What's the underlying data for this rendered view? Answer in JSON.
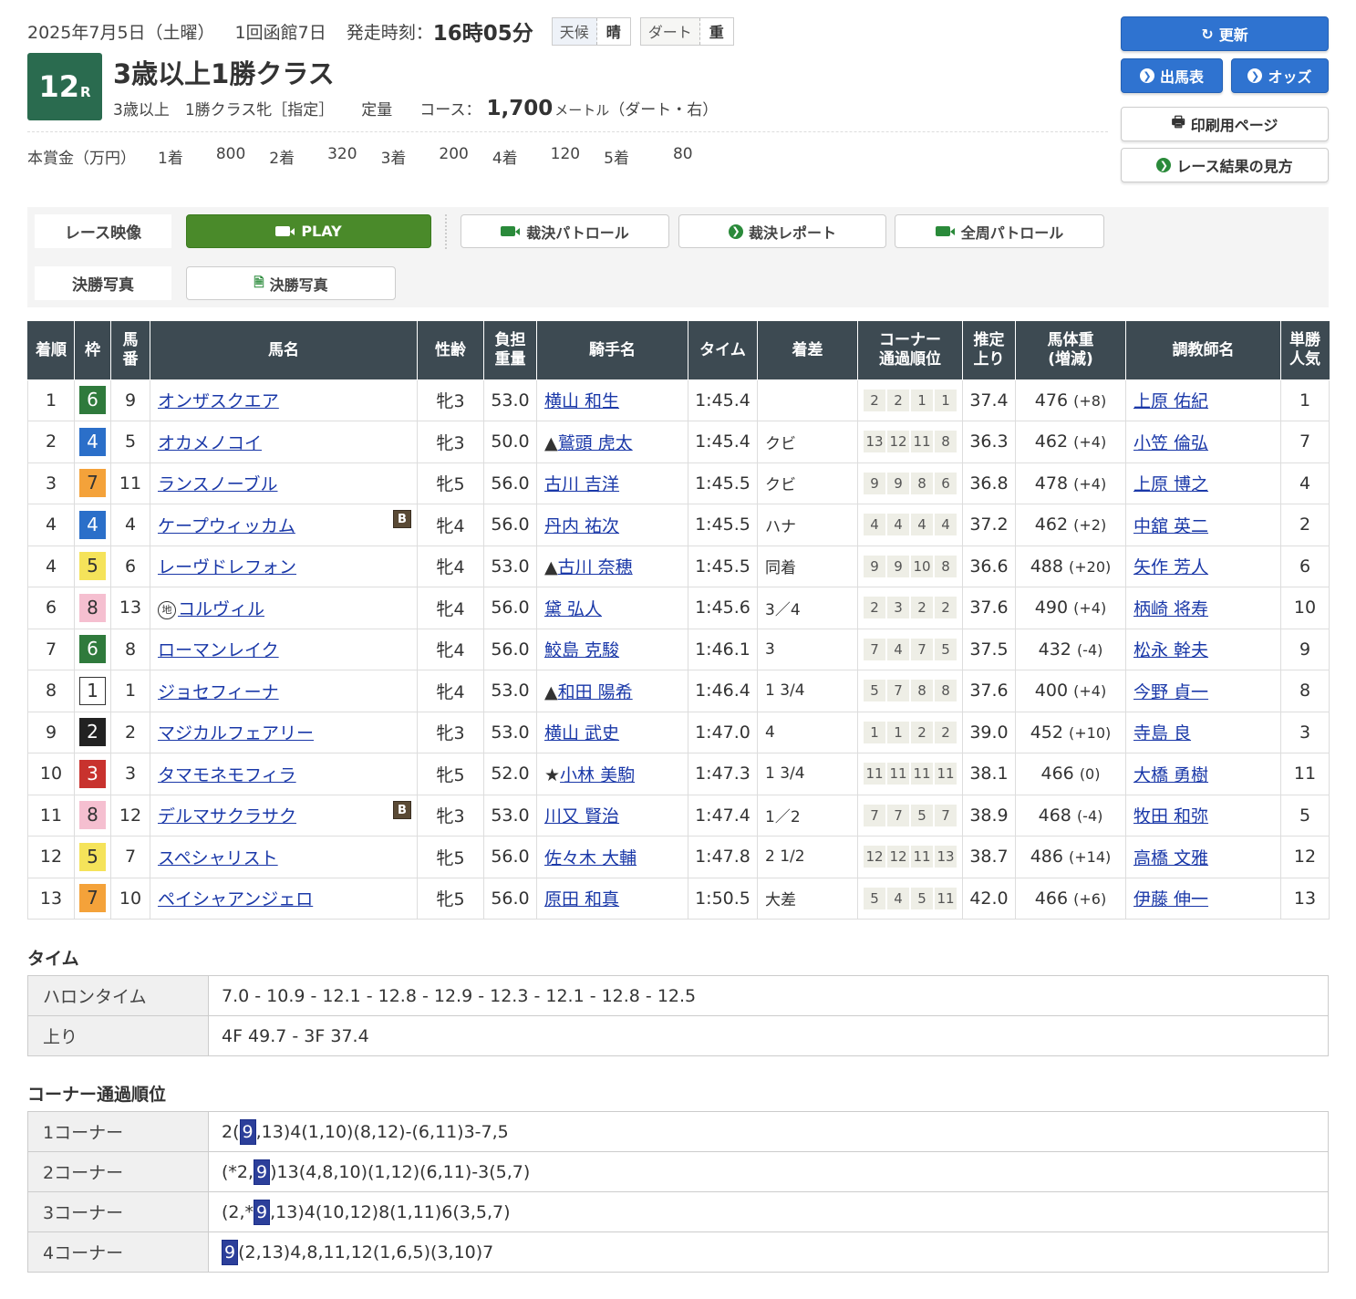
{
  "header": {
    "date": "2025年7月5日（土曜）",
    "meeting": "1回函館7日",
    "start_label": "発走時刻：",
    "start_time": "16時05分",
    "weather_label": "天候",
    "weather": "晴",
    "track_label": "ダート",
    "track_condition": "重",
    "race_no": "12",
    "race_no_suffix": "R",
    "title": "3歳以上1勝クラス",
    "class_text": "3歳以上　1勝クラス牝［指定］",
    "weight_rule": "定量",
    "course_label": "コース：",
    "distance": "1,700",
    "distance_unit": "メートル",
    "course_note": "（ダート・右）",
    "prize_label": "本賞金（万円）",
    "prizes": [
      {
        "place": "1着",
        "amount": "800"
      },
      {
        "place": "2着",
        "amount": "320"
      },
      {
        "place": "3着",
        "amount": "200"
      },
      {
        "place": "4着",
        "amount": "120"
      },
      {
        "place": "5着",
        "amount": "80"
      }
    ]
  },
  "buttons": {
    "update": "更新",
    "entries": "出馬表",
    "odds": "オッズ",
    "print": "印刷用ページ",
    "guide": "レース結果の見方"
  },
  "media": {
    "video_label": "レース映像",
    "play": "PLAY",
    "patrol": "裁決パトロール",
    "report": "裁決レポート",
    "full_patrol": "全周パトロール",
    "photo_label": "決勝写真",
    "photo_button": "決勝写真"
  },
  "table": {
    "headers": {
      "rank": "着順",
      "waku": "枠",
      "num": "馬番",
      "horse": "馬名",
      "sexage": "性齢",
      "weight": "負担重量",
      "jockey": "騎手名",
      "time": "タイム",
      "margin": "着差",
      "corner": "コーナー通過順位",
      "last3f": "推定上り",
      "bodyweight": "馬体重(増減)",
      "trainer": "調教師名",
      "pop": "単勝人気"
    },
    "rows": [
      {
        "rank": "1",
        "waku": "6",
        "num": "9",
        "horse": "オンザスクエア",
        "blinker": false,
        "chihou": false,
        "sexage": "牝3",
        "weight": "53.0",
        "jmark": "",
        "jockey": "横山 和生",
        "time": "1:45.4",
        "margin": "",
        "corners": [
          "2",
          "2",
          "1",
          "1"
        ],
        "last3f": "37.4",
        "bw": "476",
        "bwd": "(+8)",
        "trainer": "上原 佑紀",
        "pop": "1"
      },
      {
        "rank": "2",
        "waku": "4",
        "num": "5",
        "horse": "オカメノコイ",
        "blinker": false,
        "chihou": false,
        "sexage": "牝3",
        "weight": "50.0",
        "jmark": "▲",
        "jockey": "鷲頭 虎太",
        "time": "1:45.4",
        "margin": "クビ",
        "corners": [
          "13",
          "12",
          "11",
          "8"
        ],
        "last3f": "36.3",
        "bw": "462",
        "bwd": "(+4)",
        "trainer": "小笠 倫弘",
        "pop": "7"
      },
      {
        "rank": "3",
        "waku": "7",
        "num": "11",
        "horse": "ランスノーブル",
        "blinker": false,
        "chihou": false,
        "sexage": "牝5",
        "weight": "56.0",
        "jmark": "",
        "jockey": "古川 吉洋",
        "time": "1:45.5",
        "margin": "クビ",
        "corners": [
          "9",
          "9",
          "8",
          "6"
        ],
        "last3f": "36.8",
        "bw": "478",
        "bwd": "(+4)",
        "trainer": "上原 博之",
        "pop": "4"
      },
      {
        "rank": "4",
        "waku": "4",
        "num": "4",
        "horse": "ケープウィッカム",
        "blinker": true,
        "chihou": false,
        "sexage": "牝4",
        "weight": "56.0",
        "jmark": "",
        "jockey": "丹内 祐次",
        "time": "1:45.5",
        "margin": "ハナ",
        "corners": [
          "4",
          "4",
          "4",
          "4"
        ],
        "last3f": "37.2",
        "bw": "462",
        "bwd": "(+2)",
        "trainer": "中舘 英二",
        "pop": "2"
      },
      {
        "rank": "4",
        "waku": "5",
        "num": "6",
        "horse": "レーヴドレフォン",
        "blinker": false,
        "chihou": false,
        "sexage": "牝4",
        "weight": "53.0",
        "jmark": "▲",
        "jockey": "古川 奈穂",
        "time": "1:45.5",
        "margin": "同着",
        "corners": [
          "9",
          "9",
          "10",
          "8"
        ],
        "last3f": "36.6",
        "bw": "488",
        "bwd": "(+20)",
        "trainer": "矢作 芳人",
        "pop": "6"
      },
      {
        "rank": "6",
        "waku": "8",
        "num": "13",
        "horse": "コルヴィル",
        "blinker": false,
        "chihou": true,
        "sexage": "牝4",
        "weight": "56.0",
        "jmark": "",
        "jockey": "黛 弘人",
        "time": "1:45.6",
        "margin": "3／4",
        "corners": [
          "2",
          "3",
          "2",
          "2"
        ],
        "last3f": "37.6",
        "bw": "490",
        "bwd": "(+4)",
        "trainer": "柄崎 将寿",
        "pop": "10"
      },
      {
        "rank": "7",
        "waku": "6",
        "num": "8",
        "horse": "ローマンレイク",
        "blinker": false,
        "chihou": false,
        "sexage": "牝4",
        "weight": "56.0",
        "jmark": "",
        "jockey": "鮫島 克駿",
        "time": "1:46.1",
        "margin": "3",
        "corners": [
          "7",
          "4",
          "7",
          "5"
        ],
        "last3f": "37.5",
        "bw": "432",
        "bwd": "(-4)",
        "trainer": "松永 幹夫",
        "pop": "9"
      },
      {
        "rank": "8",
        "waku": "1",
        "num": "1",
        "horse": "ジョセフィーナ",
        "blinker": false,
        "chihou": false,
        "sexage": "牝4",
        "weight": "53.0",
        "jmark": "▲",
        "jockey": "和田 陽希",
        "time": "1:46.4",
        "margin": "1 3/4",
        "corners": [
          "5",
          "7",
          "8",
          "8"
        ],
        "last3f": "37.6",
        "bw": "400",
        "bwd": "(+4)",
        "trainer": "今野 貞一",
        "pop": "8"
      },
      {
        "rank": "9",
        "waku": "2",
        "num": "2",
        "horse": "マジカルフェアリー",
        "blinker": false,
        "chihou": false,
        "sexage": "牝3",
        "weight": "53.0",
        "jmark": "",
        "jockey": "横山 武史",
        "time": "1:47.0",
        "margin": "4",
        "corners": [
          "1",
          "1",
          "2",
          "2"
        ],
        "last3f": "39.0",
        "bw": "452",
        "bwd": "(+10)",
        "trainer": "寺島 良",
        "pop": "3"
      },
      {
        "rank": "10",
        "waku": "3",
        "num": "3",
        "horse": "タマモネモフィラ",
        "blinker": false,
        "chihou": false,
        "sexage": "牝5",
        "weight": "52.0",
        "jmark": "★",
        "jockey": "小林 美駒",
        "time": "1:47.3",
        "margin": "1 3/4",
        "corners": [
          "11",
          "11",
          "11",
          "11"
        ],
        "last3f": "38.1",
        "bw": "466",
        "bwd": "(0)",
        "trainer": "大橋 勇樹",
        "pop": "11"
      },
      {
        "rank": "11",
        "waku": "8",
        "num": "12",
        "horse": "デルマサクラサク",
        "blinker": true,
        "chihou": false,
        "sexage": "牝3",
        "weight": "53.0",
        "jmark": "",
        "jockey": "川又 賢治",
        "time": "1:47.4",
        "margin": "1／2",
        "corners": [
          "7",
          "7",
          "5",
          "7"
        ],
        "last3f": "38.9",
        "bw": "468",
        "bwd": "(-4)",
        "trainer": "牧田 和弥",
        "pop": "5"
      },
      {
        "rank": "12",
        "waku": "5",
        "num": "7",
        "horse": "スペシャリスト",
        "blinker": false,
        "chihou": false,
        "sexage": "牝5",
        "weight": "56.0",
        "jmark": "",
        "jockey": "佐々木 大輔",
        "time": "1:47.8",
        "margin": "2 1/2",
        "corners": [
          "12",
          "12",
          "11",
          "13"
        ],
        "last3f": "38.7",
        "bw": "486",
        "bwd": "(+14)",
        "trainer": "高橋 文雅",
        "pop": "12"
      },
      {
        "rank": "13",
        "waku": "7",
        "num": "10",
        "horse": "ペイシャアンジェロ",
        "blinker": false,
        "chihou": false,
        "sexage": "牝5",
        "weight": "56.0",
        "jmark": "",
        "jockey": "原田 和真",
        "time": "1:50.5",
        "margin": "大差",
        "corners": [
          "5",
          "4",
          "5",
          "11"
        ],
        "last3f": "42.0",
        "bw": "466",
        "bwd": "(+6)",
        "trainer": "伊藤 伸一",
        "pop": "13"
      }
    ]
  },
  "blinker_mark": "B",
  "chihou_mark": "地",
  "times": {
    "section": "タイム",
    "furlong_label": "ハロンタイム",
    "furlong": "7.0 - 10.9 - 12.1 - 12.8 - 12.9 - 12.3 - 12.1 - 12.8 - 12.5",
    "last_label": "上り",
    "last": "4F 49.7 - 3F 37.4"
  },
  "corners": {
    "section": "コーナー通過順位",
    "rows": [
      {
        "label": "1コーナー",
        "pre": "2(",
        "hl": "9",
        "post": ",13)4(1,10)(8,12)-(6,11)3-7,5"
      },
      {
        "label": "2コーナー",
        "pre": "(*2,",
        "hl": "9",
        "post": ")13(4,8,10)(1,12)(6,11)-3(5,7)"
      },
      {
        "label": "3コーナー",
        "pre": "(2,*",
        "hl": "9",
        "post": ",13)4(10,12)8(1,11)6(3,5,7)"
      },
      {
        "label": "4コーナー",
        "pre": "",
        "hl": "9",
        "post": "(2,13)4,8,11,12(1,6,5)(3,10)7"
      }
    ]
  }
}
